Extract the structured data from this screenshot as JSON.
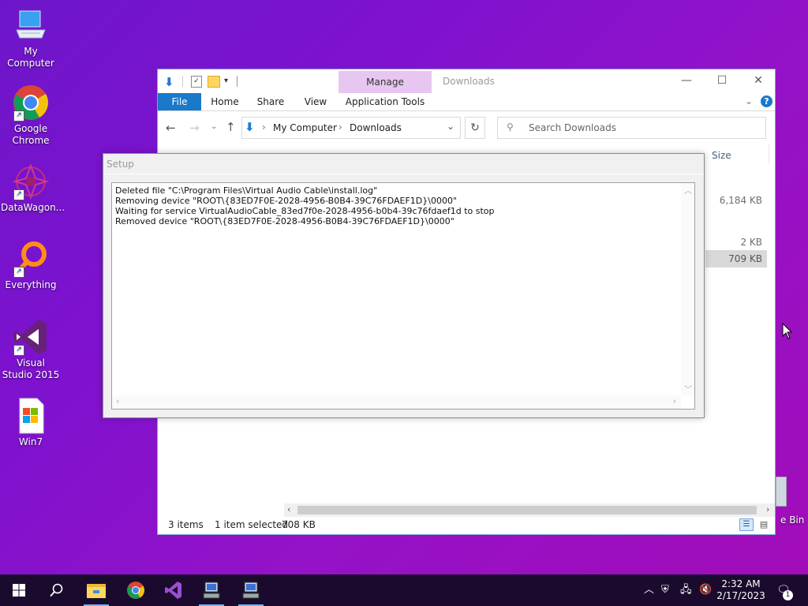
{
  "desktop": {
    "icons": [
      {
        "label": "My Computer",
        "name": "my-computer-icon"
      },
      {
        "label": "Google Chrome",
        "name": "google-chrome-icon"
      },
      {
        "label": "DataWagon...",
        "name": "datawagon-icon"
      },
      {
        "label": "Everything",
        "name": "everything-icon"
      },
      {
        "label": "Visual Studio 2015",
        "name": "visual-studio-icon"
      },
      {
        "label": "Win7",
        "name": "win7-icon"
      }
    ],
    "recycle_label": "e Bin"
  },
  "explorer": {
    "title": "Downloads",
    "context_tab": "Manage",
    "tabs": {
      "file": "File",
      "home": "Home",
      "share": "Share",
      "view": "View",
      "app_tools": "Application Tools"
    },
    "breadcrumb": {
      "root": "My Computer",
      "current": "Downloads"
    },
    "search_placeholder": "Search Downloads",
    "column_size": "Size",
    "sizes": [
      "6,184 KB",
      "2 KB",
      "709 KB"
    ],
    "status": {
      "items": "3 items",
      "selected": "1 item selected",
      "size": "708 KB"
    }
  },
  "setup": {
    "title": "Setup",
    "log": [
      "Deleted file \"C:\\Program Files\\Virtual Audio Cable\\install.log\"",
      "Removing device \"ROOT\\{83ED7F0E-2028-4956-B0B4-39C76FDAEF1D}\\0000\"",
      "Waiting for service VirtualAudioCable_83ed7f0e-2028-4956-b0b4-39c76fdaef1d to stop",
      "Removed device \"ROOT\\{83ED7F0E-2028-4956-B0B4-39C76FDAEF1D}\\0000\""
    ]
  },
  "taskbar": {
    "time": "2:32 AM",
    "date": "2/17/2023",
    "notification_count": "1"
  },
  "colors": {
    "accent": "#0078d7",
    "manage_tab": "#e7c6f1",
    "taskbar": "#1a0b2e"
  }
}
